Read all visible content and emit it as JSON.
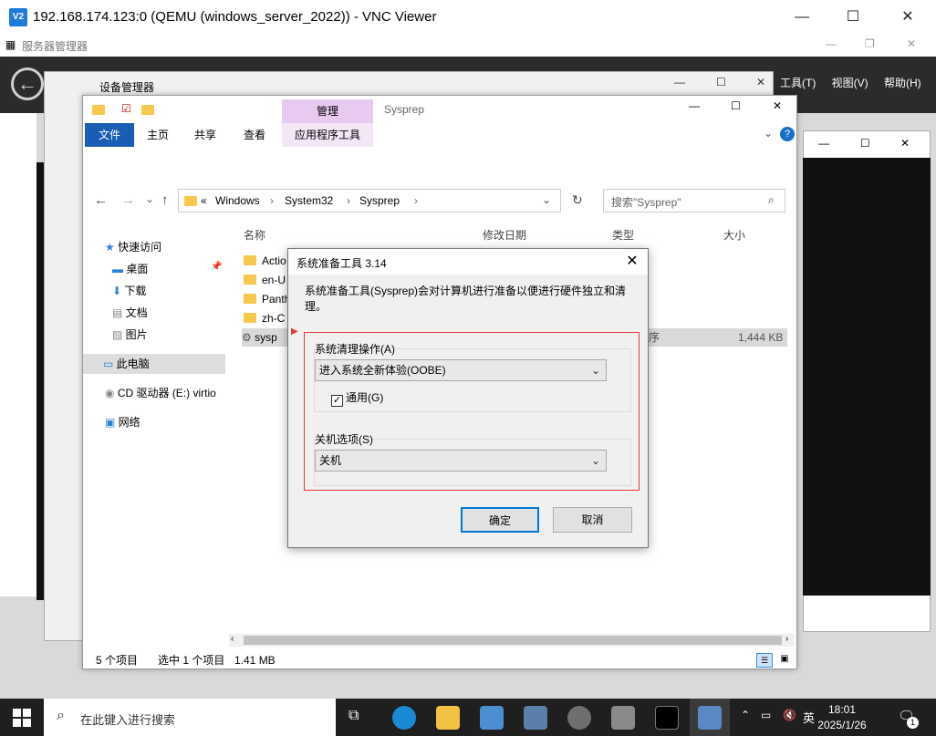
{
  "vnc": {
    "logo": "V2",
    "title": "192.168.174.123:0 (QEMU (windows_server_2022)) - VNC Viewer",
    "minimize": "—",
    "maximize": "☐",
    "close": "✕"
  },
  "server_manager": {
    "title": "服务器管理器",
    "menu": [
      "工具(T)",
      "视图(V)",
      "帮助(H)"
    ]
  },
  "device_manager": {
    "title": "设备管理器"
  },
  "explorer": {
    "ribbon_title": "Sysprep",
    "manage_tab": "管理",
    "tabs": [
      "文件",
      "主页",
      "共享",
      "查看",
      "应用程序工具"
    ],
    "address": [
      "Windows",
      "System32",
      "Sysprep"
    ],
    "address_prefix": "«",
    "search_placeholder": "搜索\"Sysprep\"",
    "nav": [
      "快速访问",
      "桌面",
      "下载",
      "文档",
      "图片",
      "此电脑",
      "CD 驱动器 (E:) virtio",
      "网络"
    ],
    "columns": [
      "名称",
      "修改日期",
      "类型",
      "大小"
    ],
    "files": [
      "Actio",
      "en-U",
      "Panth",
      "zh-C",
      "sysp"
    ],
    "selected_type_fragment": "序",
    "selected_size": "1,444 KB",
    "status": {
      "count": "5 个项目",
      "selected": "选中 1 个项目",
      "size": "1.41 MB"
    }
  },
  "dialog": {
    "title": "系统准备工具 3.14",
    "description": "系统准备工具(Sysprep)会对计算机进行准备以便进行硬件独立和清理。",
    "cleanup_label": "系统清理操作(A)",
    "cleanup_value": "进入系统全新体验(OOBE)",
    "generalize_label": "通用(G)",
    "generalize_checked": true,
    "shutdown_label": "关机选项(S)",
    "shutdown_value": "关机",
    "ok": "确定",
    "cancel": "取消"
  },
  "taskbar": {
    "search_placeholder": "在此键入进行搜索",
    "ime": "英",
    "time": "18:01",
    "date": "2025/1/26",
    "notifications": "1"
  },
  "colors": {
    "accent": "#0078d7",
    "highlight_box": "#e23b3b",
    "file_tab": "#1a5eb3",
    "taskbar": "#1f1f1f"
  }
}
